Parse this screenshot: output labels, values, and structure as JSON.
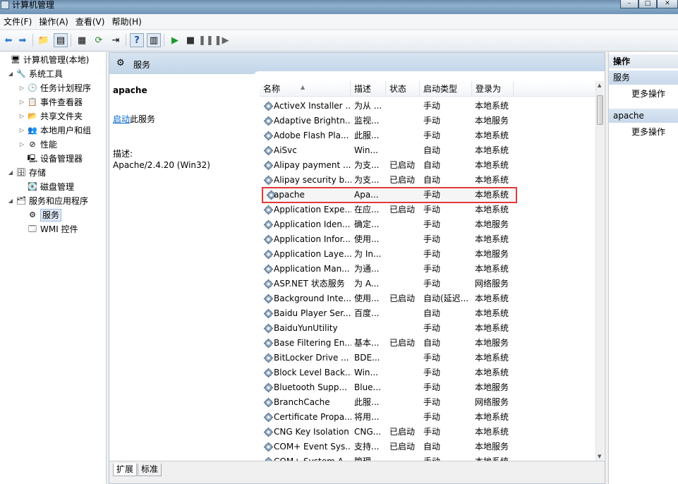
{
  "window": {
    "title": "计算机管理"
  },
  "menu": [
    "文件(F)",
    "操作(A)",
    "查看(V)",
    "帮助(H)"
  ],
  "tree": [
    {
      "label": "计算机管理(本地)",
      "level": 0,
      "icon": "computer-icon",
      "expander": ""
    },
    {
      "label": "系统工具",
      "level": 1,
      "icon": "tools-icon",
      "expander": "◢"
    },
    {
      "label": "任务计划程序",
      "level": 2,
      "icon": "clock-icon",
      "expander": "▷"
    },
    {
      "label": "事件查看器",
      "level": 2,
      "icon": "event-viewer-icon",
      "expander": "▷"
    },
    {
      "label": "共享文件夹",
      "level": 2,
      "icon": "shared-folder-icon",
      "expander": "▷"
    },
    {
      "label": "本地用户和组",
      "level": 2,
      "icon": "users-icon",
      "expander": "▷"
    },
    {
      "label": "性能",
      "level": 2,
      "icon": "performance-icon",
      "expander": "▷"
    },
    {
      "label": "设备管理器",
      "level": 2,
      "icon": "device-manager-icon",
      "expander": ""
    },
    {
      "label": "存储",
      "level": 1,
      "icon": "storage-icon",
      "expander": "◢"
    },
    {
      "label": "磁盘管理",
      "level": 2,
      "icon": "disk-icon",
      "expander": ""
    },
    {
      "label": "服务和应用程序",
      "level": 1,
      "icon": "services-apps-icon",
      "expander": "◢"
    },
    {
      "label": "服务",
      "level": 2,
      "icon": "services-gear-icon",
      "expander": "",
      "selected": true
    },
    {
      "label": "WMI 控件",
      "level": 2,
      "icon": "wmi-icon",
      "expander": ""
    }
  ],
  "center": {
    "header_title": "服务",
    "selected_service": {
      "name": "apache",
      "link_text": "启动",
      "link_suffix": "此服务",
      "desc_label": "描述:",
      "desc_value": "Apache/2.4.20 (Win32)"
    },
    "columns": [
      "名称",
      "描述",
      "状态",
      "启动类型",
      "登录为"
    ],
    "services": [
      {
        "name": "ActiveX Installer ...",
        "desc": "为从 ...",
        "status": "",
        "startup": "手动",
        "logon": "本地系统"
      },
      {
        "name": "Adaptive Brightn...",
        "desc": "监视...",
        "status": "",
        "startup": "手动",
        "logon": "本地服务"
      },
      {
        "name": "Adobe Flash Pla...",
        "desc": "此服...",
        "status": "",
        "startup": "手动",
        "logon": "本地系统"
      },
      {
        "name": "AiSvc",
        "desc": "Win...",
        "status": "",
        "startup": "自动",
        "logon": "本地系统"
      },
      {
        "name": "Alipay payment ...",
        "desc": "为支...",
        "status": "已启动",
        "startup": "自动",
        "logon": "本地系统"
      },
      {
        "name": "Alipay security b...",
        "desc": "为支...",
        "status": "已启动",
        "startup": "自动",
        "logon": "本地系统"
      },
      {
        "name": "apache",
        "desc": "Apa...",
        "status": "",
        "startup": "手动",
        "logon": "本地系统",
        "highlight": true
      },
      {
        "name": "Application Expe...",
        "desc": "在应...",
        "status": "已启动",
        "startup": "手动",
        "logon": "本地系统"
      },
      {
        "name": "Application Iden...",
        "desc": "确定...",
        "status": "",
        "startup": "手动",
        "logon": "本地服务"
      },
      {
        "name": "Application Infor...",
        "desc": "使用...",
        "status": "",
        "startup": "手动",
        "logon": "本地系统"
      },
      {
        "name": "Application Laye...",
        "desc": "为 In...",
        "status": "",
        "startup": "手动",
        "logon": "本地服务"
      },
      {
        "name": "Application Man...",
        "desc": "为通...",
        "status": "",
        "startup": "手动",
        "logon": "本地系统"
      },
      {
        "name": "ASP.NET 状态服务",
        "desc": "为 A...",
        "status": "",
        "startup": "手动",
        "logon": "网络服务"
      },
      {
        "name": "Background Inte...",
        "desc": "使用...",
        "status": "已启动",
        "startup": "自动(延迟...",
        "logon": "本地系统"
      },
      {
        "name": "Baidu Player Ser...",
        "desc": "百度...",
        "status": "",
        "startup": "自动",
        "logon": "本地系统"
      },
      {
        "name": "BaiduYunUtility",
        "desc": "",
        "status": "",
        "startup": "手动",
        "logon": "本地系统"
      },
      {
        "name": "Base Filtering En...",
        "desc": "基本...",
        "status": "已启动",
        "startup": "自动",
        "logon": "本地服务"
      },
      {
        "name": "BitLocker Drive ...",
        "desc": "BDE...",
        "status": "",
        "startup": "手动",
        "logon": "本地系统"
      },
      {
        "name": "Block Level Back...",
        "desc": "Win...",
        "status": "",
        "startup": "手动",
        "logon": "本地系统"
      },
      {
        "name": "Bluetooth Supp...",
        "desc": "Blue...",
        "status": "",
        "startup": "手动",
        "logon": "本地服务"
      },
      {
        "name": "BranchCache",
        "desc": "此服...",
        "status": "",
        "startup": "手动",
        "logon": "网络服务"
      },
      {
        "name": "Certificate Propa...",
        "desc": "将用...",
        "status": "",
        "startup": "手动",
        "logon": "本地系统"
      },
      {
        "name": "CNG Key Isolation",
        "desc": "CNG...",
        "status": "已启动",
        "startup": "手动",
        "logon": "本地系统"
      },
      {
        "name": "COM+ Event Sys...",
        "desc": "支持...",
        "status": "已启动",
        "startup": "自动",
        "logon": "本地服务"
      },
      {
        "name": "COM+ System A...",
        "desc": "管理...",
        "status": "",
        "startup": "手动",
        "logon": "本地系统"
      }
    ],
    "tabs": [
      "扩展",
      "标准"
    ]
  },
  "actions": {
    "header": "操作",
    "sections": [
      {
        "title": "服务",
        "item": "更多操作"
      },
      {
        "title": "apache",
        "item": "更多操作"
      }
    ]
  }
}
